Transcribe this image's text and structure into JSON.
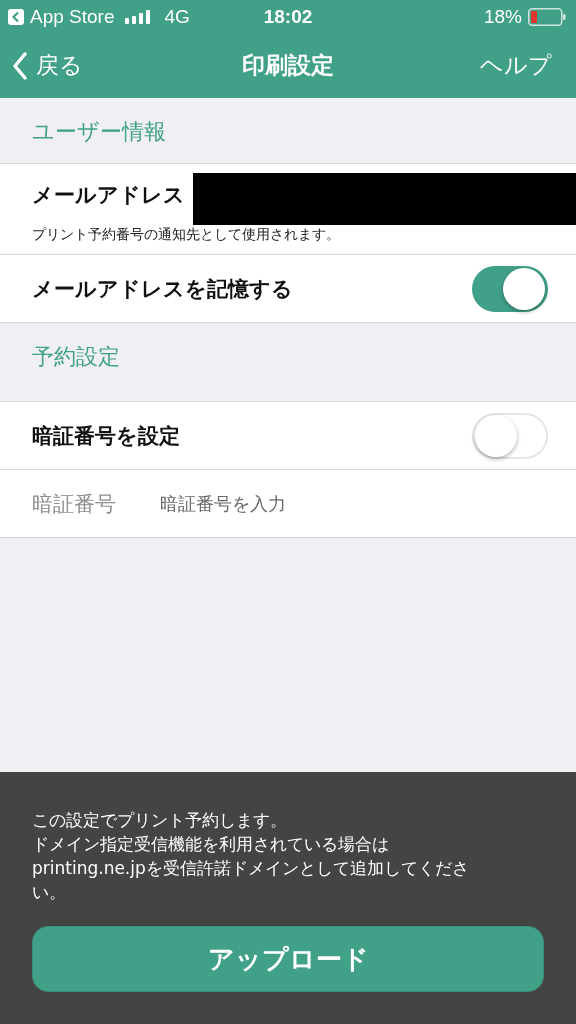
{
  "status_bar": {
    "back_app": "App Store",
    "network": "4G",
    "time": "18:02",
    "battery": "18%"
  },
  "nav": {
    "back": "戻る",
    "title": "印刷設定",
    "help": "ヘルプ"
  },
  "sections": [
    {
      "title": "ユーザー情報",
      "rows": [
        {
          "kind": "email",
          "label": "メールアドレス",
          "note": "プリント予約番号の通知先として使用されます。"
        },
        {
          "kind": "toggle",
          "label": "メールアドレスを記憶する",
          "on": true
        }
      ]
    },
    {
      "title": "予約設定",
      "rows": [
        {
          "kind": "toggle",
          "label": "暗証番号を設定",
          "on": false
        },
        {
          "kind": "input",
          "label": "暗証番号",
          "placeholder": "暗証番号を入力"
        }
      ]
    }
  ],
  "footer": {
    "notice_lines": [
      "この設定でプリント予約します。",
      "ドメイン指定受信機能を利用されている場合は",
      "printing.ne.jpを受信許諾ドメインとして追加してください。"
    ],
    "button": "アップロード"
  }
}
